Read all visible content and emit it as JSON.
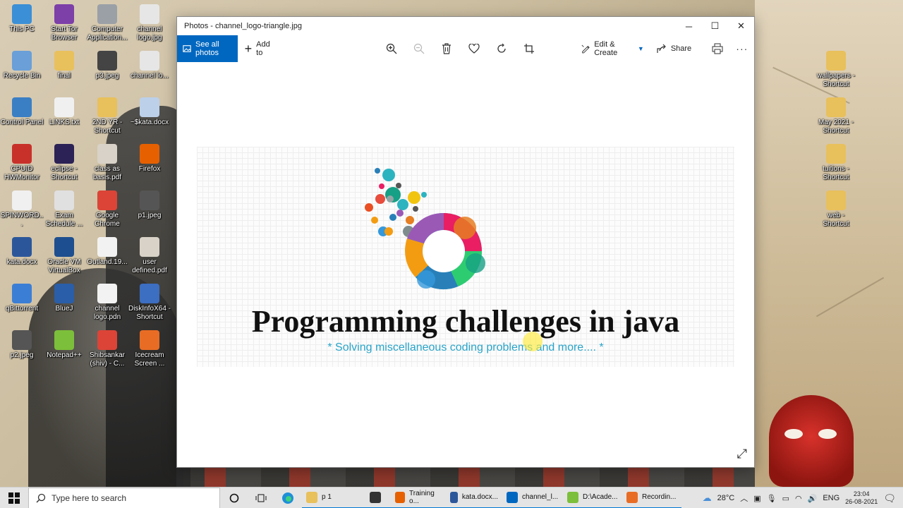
{
  "desktop": {
    "icons": [
      {
        "label": "This PC",
        "icon": "this-pc-icon",
        "color": "#3b8fd6"
      },
      {
        "label": "Start Tor Browser",
        "icon": "tor-browser-icon",
        "color": "#7d3fa8"
      },
      {
        "label": "Computer Application...",
        "icon": "document-icon",
        "color": "#9aa0a6"
      },
      {
        "label": "channel logo.jpg",
        "icon": "image-file-icon",
        "color": "#e6e6e6"
      },
      {
        "label": "Recycle Bin",
        "icon": "recycle-bin-icon",
        "color": "#6a9fd8"
      },
      {
        "label": "final",
        "icon": "folder-icon",
        "color": "#e8c05c"
      },
      {
        "label": "p3.jpeg",
        "icon": "image-file-icon",
        "color": "#444444"
      },
      {
        "label": "channel lo...",
        "icon": "image-file-icon",
        "color": "#e6e6e6"
      },
      {
        "label": "Control Panel",
        "icon": "control-panel-icon",
        "color": "#3a7fc4"
      },
      {
        "label": "LINKS.txt",
        "icon": "text-file-icon",
        "color": "#f0f0f0"
      },
      {
        "label": "2ND YR - Shortcut",
        "icon": "folder-icon",
        "color": "#e8c05c"
      },
      {
        "label": "~$kata.docx",
        "icon": "word-file-icon",
        "color": "#bcd0ea"
      },
      {
        "label": "CPUID HWMonitor",
        "icon": "hwmonitor-icon",
        "color": "#c8312a"
      },
      {
        "label": "eclipse - Shortcut",
        "icon": "eclipse-icon",
        "color": "#2c2255"
      },
      {
        "label": "class as basis.pdf",
        "icon": "pdf-file-icon",
        "color": "#d8d2c8"
      },
      {
        "label": "Firefox",
        "icon": "firefox-icon",
        "color": "#e66000"
      },
      {
        "label": "SPINWORD...",
        "icon": "text-file-icon",
        "color": "#f0f0f0"
      },
      {
        "label": "Exam Schedule ...",
        "icon": "pdf-file-icon",
        "color": "#e0e0e0"
      },
      {
        "label": "Google Chrome",
        "icon": "chrome-icon",
        "color": "#db4437"
      },
      {
        "label": "p1.jpeg",
        "icon": "image-file-icon",
        "color": "#555555"
      },
      {
        "label": "kata.docx",
        "icon": "word-file-icon",
        "color": "#2b579a"
      },
      {
        "label": "Oracle VM VirtualBox",
        "icon": "virtualbox-icon",
        "color": "#1d4e8f"
      },
      {
        "label": "Outland.19...",
        "icon": "document-icon",
        "color": "#f2f2f2"
      },
      {
        "label": "user defined.pdf",
        "icon": "pdf-file-icon",
        "color": "#d8d2c8"
      },
      {
        "label": "qBittorrent",
        "icon": "qbittorrent-icon",
        "color": "#3b7ed6"
      },
      {
        "label": "BlueJ",
        "icon": "bluej-icon",
        "color": "#2a5ea8"
      },
      {
        "label": "channel logo.pdn",
        "icon": "image-file-icon",
        "color": "#f2f2f2"
      },
      {
        "label": "DiskInfoX64 - Shortcut",
        "icon": "diskinfo-icon",
        "color": "#3c6ec2"
      },
      {
        "label": "p2.jpeg",
        "icon": "image-file-icon",
        "color": "#555555"
      },
      {
        "label": "Notepad++",
        "icon": "notepadpp-icon",
        "color": "#7cbf3a"
      },
      {
        "label": "Shibsankar (shiv) - C...",
        "icon": "chrome-profile-icon",
        "color": "#db4437"
      },
      {
        "label": "Icecream Screen ...",
        "icon": "icecream-icon",
        "color": "#e86c24"
      }
    ],
    "right_icons": [
      {
        "label": "wallpapers - Shortcut",
        "icon": "folder-icon",
        "color": "#e8c05c"
      },
      {
        "label": "May 2021 - Shortcut",
        "icon": "folder-icon",
        "color": "#e8c05c"
      },
      {
        "label": "tuitions - Shortcut",
        "icon": "folder-icon",
        "color": "#e8c05c"
      },
      {
        "label": "web - Shortcut",
        "icon": "folder-icon",
        "color": "#e8c05c"
      }
    ]
  },
  "window": {
    "title": "Photos - channel_logo-triangle.jpg",
    "controls": {
      "minimize": "─",
      "maximize": "☐",
      "close": "✕"
    }
  },
  "toolbar": {
    "see_all": "See all photos",
    "add_to": "Add to",
    "edit_create": "Edit & Create",
    "share": "Share",
    "accent": "#0067c0"
  },
  "image": {
    "headline": "Programming challenges in java",
    "subline": "* Solving miscellaneous coding problems and more.... *",
    "sub_color": "#29a4c9"
  },
  "taskbar": {
    "search_placeholder": "Type here to search",
    "apps": [
      {
        "label": "p 1",
        "icon": "folder-icon",
        "color": "#e8c05c"
      },
      {
        "label": "",
        "icon": "store-icon",
        "color": "#333333"
      },
      {
        "label": "Training o...",
        "icon": "firefox-icon",
        "color": "#e66000"
      },
      {
        "label": "kata.docx...",
        "icon": "word-icon",
        "color": "#2b579a"
      },
      {
        "label": "channel_l...",
        "icon": "photos-icon",
        "color": "#0067c0"
      },
      {
        "label": "D:\\Acade...",
        "icon": "notepadpp-icon",
        "color": "#7cbf3a"
      },
      {
        "label": "Recordin...",
        "icon": "icecream-icon",
        "color": "#e86c24"
      }
    ],
    "temperature": "28°C",
    "language": "ENG",
    "time": "23:04",
    "date": "26-08-2021"
  }
}
